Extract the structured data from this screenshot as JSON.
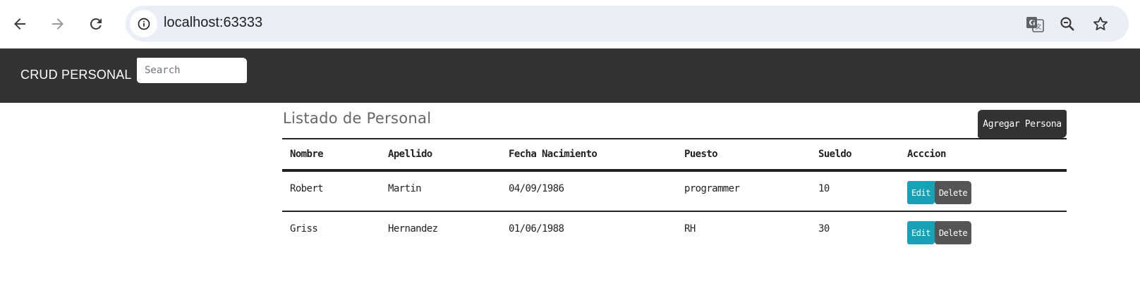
{
  "browser": {
    "url": "localhost:63333",
    "icons": {
      "back": "arrow-left-icon",
      "forward": "arrow-right-icon",
      "reload": "reload-icon",
      "site_info": "info-icon",
      "translate": "translate-icon",
      "zoom": "zoom-icon",
      "bookmark": "star-icon"
    }
  },
  "navbar": {
    "brand": "CRUD PERSONAL",
    "search_placeholder": "Search"
  },
  "main": {
    "title": "Listado de Personal",
    "add_button": "Agregar Persona",
    "table": {
      "headers": [
        "Nombre",
        "Apellido",
        "Fecha Nacimiento",
        "Puesto",
        "Sueldo",
        "Acccion"
      ],
      "rows": [
        {
          "nombre": "Robert",
          "apellido": "Martin",
          "fecha": "04/09/1986",
          "puesto": "programmer",
          "sueldo": "10",
          "edit": "Edit",
          "delete": "Delete"
        },
        {
          "nombre": "Griss",
          "apellido": "Hernandez",
          "fecha": "01/06/1988",
          "puesto": "RH",
          "sueldo": "30",
          "edit": "Edit",
          "delete": "Delete"
        }
      ]
    }
  },
  "colors": {
    "navbar_bg": "#333333",
    "edit_button": "#17a2b8",
    "delete_button": "#555555",
    "omnibox_bg": "#e9eef7"
  }
}
